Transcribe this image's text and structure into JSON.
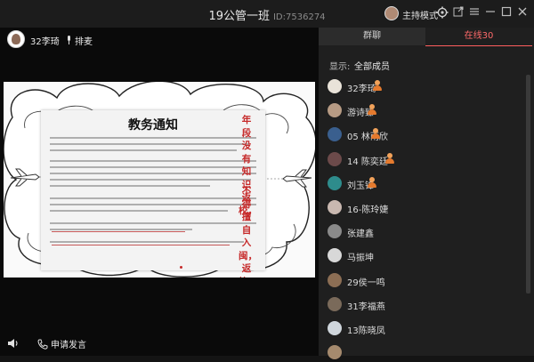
{
  "window": {
    "title": "19公管一班",
    "room_id": "ID:7536274",
    "host_mode": "主持模式"
  },
  "presenter": {
    "name": "32李琦",
    "mic_queue": "排麦"
  },
  "slide": {
    "heading": "教务通知",
    "right_note": "年段没有知识返校，",
    "right_note_2": "不得擅自入闽，返校！！"
  },
  "bottom": {
    "apply_speak": "申请发言"
  },
  "tabs": {
    "group_chat": "群聊",
    "online": "在线30"
  },
  "filter": {
    "label": "显示:",
    "value": "全部成员"
  },
  "members": [
    {
      "name": "32李琦",
      "badge": true,
      "avatar_color": "#e9e3d9"
    },
    {
      "name": "游诗臻",
      "badge": true,
      "avatar_color": "#b79b84"
    },
    {
      "name": "05 林雨欣",
      "badge": true,
      "avatar_color": "#3a5f8e"
    },
    {
      "name": "14 陈奕廷",
      "badge": true,
      "avatar_color": "#6c4a4a"
    },
    {
      "name": "刘玉锋",
      "badge": true,
      "avatar_color": "#2e8c8c"
    },
    {
      "name": "16-陈玲婕",
      "badge": false,
      "avatar_color": "#c9b8b0"
    },
    {
      "name": "张建鑫",
      "badge": false,
      "avatar_color": "#8a8a8a"
    },
    {
      "name": "马振坤",
      "badge": false,
      "avatar_color": "#d8d8d8"
    },
    {
      "name": "29侯一鸣",
      "badge": false,
      "avatar_color": "#8c6e54"
    },
    {
      "name": "31李福燕",
      "badge": false,
      "avatar_color": "#7a6a5a"
    },
    {
      "name": "13陈晓凤",
      "badge": false,
      "avatar_color": "#cfd6dc"
    },
    {
      "name": "",
      "badge": false,
      "avatar_color": "#a58a6e"
    }
  ],
  "icons": {
    "settings": "gear-icon",
    "popout": "popout-icon",
    "menu": "menu-icon",
    "minimize": "minimize-icon",
    "maximize": "maximize-icon",
    "close": "close-icon",
    "speaker": "speaker-icon",
    "apply": "phone-icon",
    "mic": "microphone-icon"
  },
  "colors": {
    "accent": "#ff5e5e",
    "badge": "#e57a2e",
    "notice_red": "#c62a2a"
  }
}
